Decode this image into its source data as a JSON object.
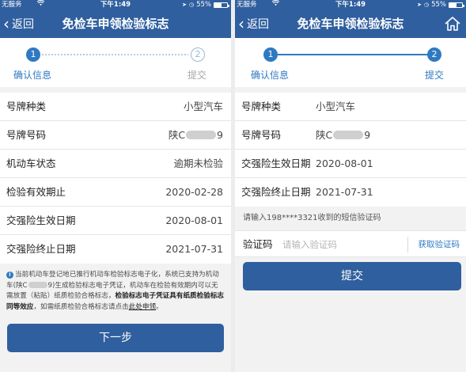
{
  "status_bar": {
    "carrier": "无服务",
    "wifi": "wifi-icon",
    "time": "下午1:49",
    "battery": "55%"
  },
  "nav": {
    "back_label": "返回",
    "title": "免检车申领检验标志"
  },
  "steps": [
    {
      "number": "1",
      "label": "确认信息"
    },
    {
      "number": "2",
      "label": "提交"
    }
  ],
  "left_screen": {
    "rows": [
      {
        "label": "号牌种类",
        "value": "小型汽车"
      },
      {
        "label": "号牌号码",
        "value_prefix": "陕C",
        "value_suffix": "9"
      },
      {
        "label": "机动车状态",
        "value": "逾期未检验"
      },
      {
        "label": "检验有效期止",
        "value": "2020-02-28"
      },
      {
        "label": "交强险生效日期",
        "value": "2020-08-01"
      },
      {
        "label": "交强险终止日期",
        "value": "2021-07-31"
      }
    ],
    "notice": {
      "p1": "当前机动车登记地已推行机动车检验标志电子化，系统已支持为机动车(陕C",
      "p2": "9)生成检验标志电子凭证，机动车在检验有效期内可以无需放置（粘贴）纸质检验合格标志，",
      "bold": "检验标志电子凭证具有纸质检验标志同等效应",
      "p3": "，如需纸质检验合格标志请点击",
      "link": "此处申领",
      "end": "。"
    },
    "next_button": "下一步"
  },
  "right_screen": {
    "rows": [
      {
        "label": "号牌种类",
        "value": "小型汽车"
      },
      {
        "label": "号牌号码",
        "value_prefix": "陕C",
        "value_suffix": "9"
      },
      {
        "label": "交强险生效日期",
        "value": "2020-08-01"
      },
      {
        "label": "交强险终止日期",
        "value": "2021-07-31"
      }
    ],
    "sms_hint": "请输入198****3321收到的短信验证码",
    "code_label": "验证码",
    "code_placeholder": "请输入验证码",
    "get_code": "获取验证码",
    "submit_button": "提交"
  },
  "colors": {
    "nav_bg": "#2f5f9e",
    "accent": "#2f79c2",
    "button": "#2f5f9e"
  }
}
